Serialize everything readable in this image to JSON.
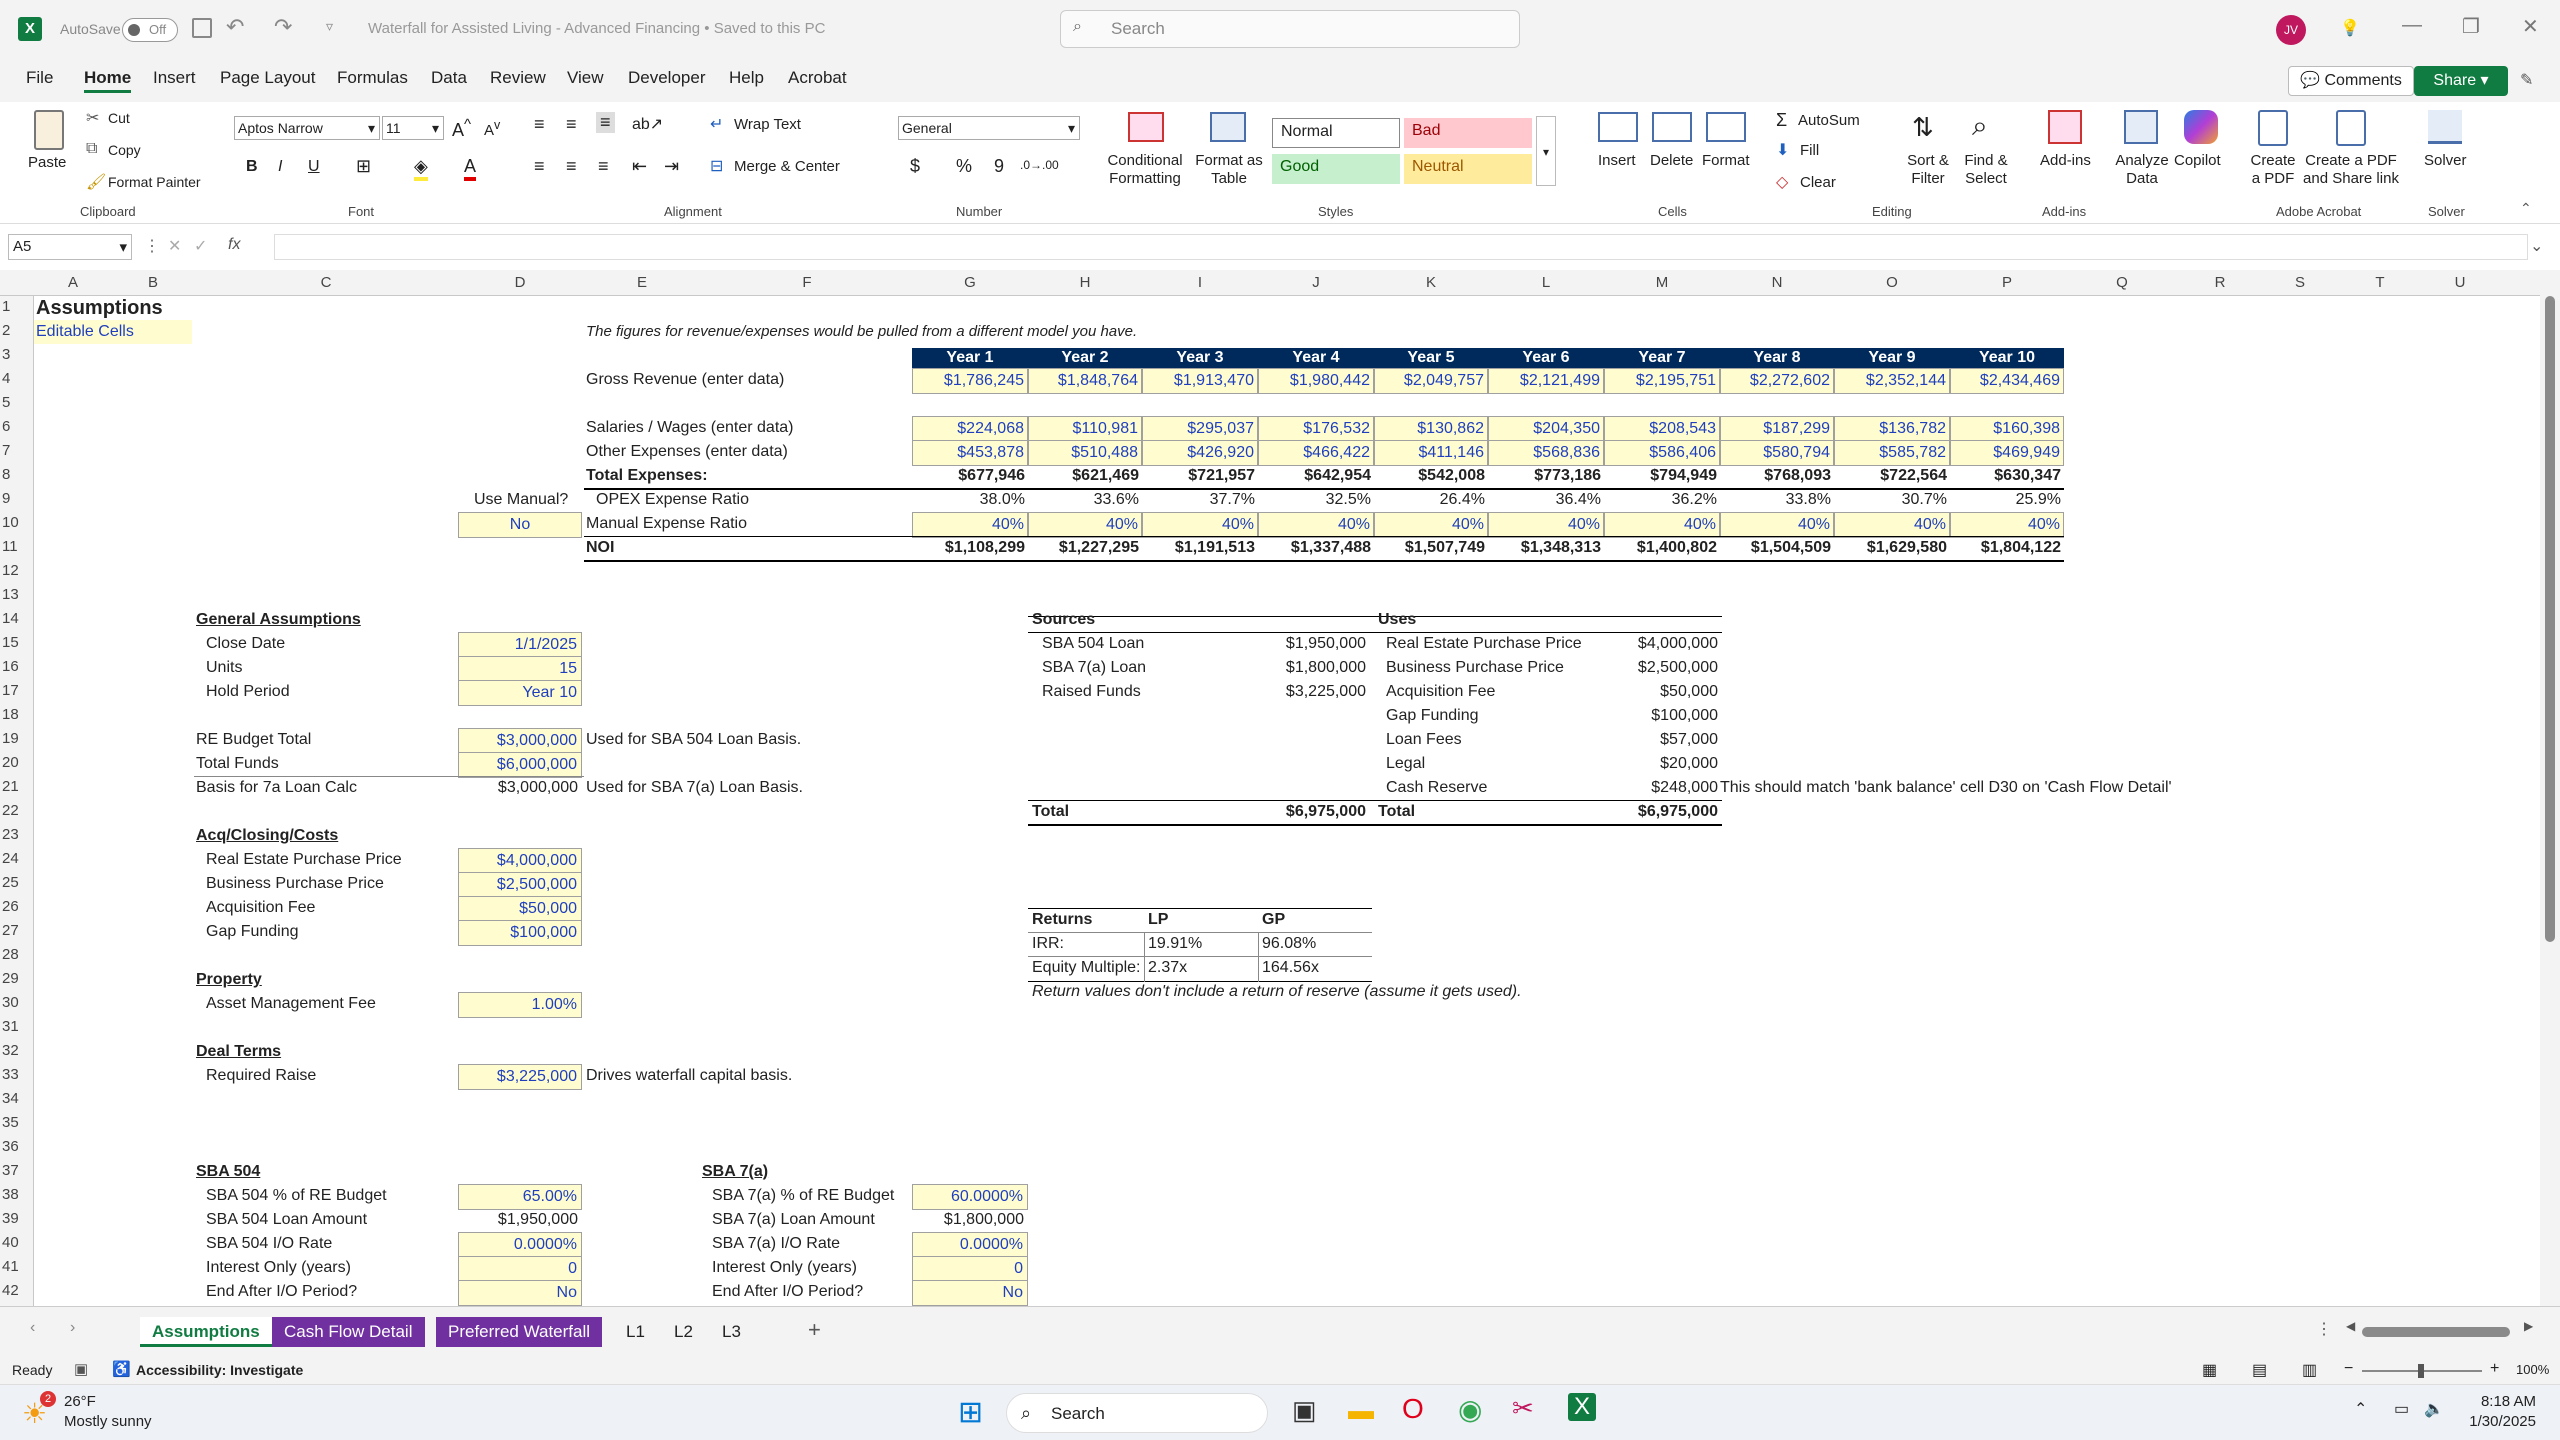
{
  "titlebar": {
    "autosave": "AutoSave",
    "autosave_state": "Off",
    "doc_title": "Waterfall for Assisted Living - Advanced Financing • Saved to this PC",
    "search_placeholder": "Search",
    "user_initials": "JV"
  },
  "menu": [
    "File",
    "Home",
    "Insert",
    "Page Layout",
    "Formulas",
    "Data",
    "Review",
    "View",
    "Developer",
    "Help",
    "Acrobat"
  ],
  "comments_label": "Comments",
  "share_label": "Share",
  "ribbon": {
    "clipboard": {
      "paste": "Paste",
      "cut": "Cut",
      "copy": "Copy",
      "format_painter": "Format Painter",
      "group": "Clipboard"
    },
    "font": {
      "name": "Aptos Narrow",
      "size": "11",
      "group": "Font"
    },
    "alignment": {
      "wrap": "Wrap Text",
      "merge": "Merge & Center",
      "group": "Alignment"
    },
    "number": {
      "format": "General",
      "group": "Number"
    },
    "styles": {
      "cond": "Conditional Formatting",
      "table": "Format as Table",
      "normal": "Normal",
      "bad": "Bad",
      "good": "Good",
      "neutral": "Neutral",
      "group": "Styles"
    },
    "cells": {
      "insert": "Insert",
      "delete": "Delete",
      "format": "Format",
      "group": "Cells"
    },
    "editing": {
      "autosum": "AutoSum",
      "fill": "Fill",
      "clear": "Clear",
      "sort": "Sort & Filter",
      "find": "Find & Select",
      "group": "Editing"
    },
    "addins": {
      "label": "Add-ins",
      "group": "Add-ins"
    },
    "analyze": "Analyze Data",
    "copilot": "Copilot",
    "acrobat": {
      "pdf": "Create a PDF",
      "share": "Create a PDF and Share link",
      "group": "Adobe Acrobat"
    },
    "solver": {
      "label": "Solver",
      "group": "Solver"
    }
  },
  "namebox": "A5",
  "fx": "fx",
  "columns": [
    "A",
    "B",
    "C",
    "D",
    "E",
    "F",
    "G",
    "H",
    "I",
    "J",
    "K",
    "L",
    "M",
    "N",
    "O",
    "P",
    "Q",
    "R",
    "S",
    "T",
    "U"
  ],
  "sheet": {
    "title": "Assumptions",
    "editable": "Editable Cells",
    "note": "The figures for revenue/expenses would be pulled from a different model you have.",
    "years": [
      "Year 1",
      "Year 2",
      "Year 3",
      "Year 4",
      "Year 5",
      "Year 6",
      "Year 7",
      "Year 8",
      "Year 9",
      "Year 10"
    ],
    "gross_label": "Gross Revenue (enter data)",
    "gross": [
      "$1,786,245",
      "$1,848,764",
      "$1,913,470",
      "$1,980,442",
      "$2,049,757",
      "$2,121,499",
      "$2,195,751",
      "$2,272,602",
      "$2,352,144",
      "$2,434,469"
    ],
    "sal_label": "Salaries / Wages (enter data)",
    "sal": [
      "$224,068",
      "$110,981",
      "$295,037",
      "$176,532",
      "$130,862",
      "$204,350",
      "$208,543",
      "$187,299",
      "$136,782",
      "$160,398"
    ],
    "oth_label": "Other Expenses (enter data)",
    "oth": [
      "$453,878",
      "$510,488",
      "$426,920",
      "$466,422",
      "$411,146",
      "$568,836",
      "$586,406",
      "$580,794",
      "$585,782",
      "$469,949"
    ],
    "tot_label": "Total Expenses:",
    "tot": [
      "$677,946",
      "$621,469",
      "$721,957",
      "$642,954",
      "$542,008",
      "$773,186",
      "$794,949",
      "$768,093",
      "$722,564",
      "$630,347"
    ],
    "use_manual_label": "Use Manual?",
    "use_manual": "No",
    "opex_label": "OPEX Expense Ratio",
    "opex": [
      "38.0%",
      "33.6%",
      "37.7%",
      "32.5%",
      "26.4%",
      "36.4%",
      "36.2%",
      "33.8%",
      "30.7%",
      "25.9%"
    ],
    "manual_label": "Manual Expense Ratio",
    "manual": [
      "40%",
      "40%",
      "40%",
      "40%",
      "40%",
      "40%",
      "40%",
      "40%",
      "40%",
      "40%"
    ],
    "noi_label": "NOI",
    "noi": [
      "$1,108,299",
      "$1,227,295",
      "$1,191,513",
      "$1,337,488",
      "$1,507,749",
      "$1,348,313",
      "$1,400,802",
      "$1,504,509",
      "$1,629,580",
      "$1,804,122"
    ],
    "general": {
      "heading": "General Assumptions",
      "close_label": "Close Date",
      "close": "1/1/2025",
      "units_label": "Units",
      "units": "15",
      "hold_label": "Hold Period",
      "hold": "Year 10"
    },
    "re_budget_label": "RE Budget Total",
    "re_budget": "$3,000,000",
    "re_note": "Used for SBA 504 Loan Basis.",
    "total_funds_label": "Total Funds",
    "total_funds": "$6,000,000",
    "basis_label": "Basis for 7a Loan Calc",
    "basis": "$3,000,000",
    "basis_note": "Used for SBA 7(a) Loan Basis.",
    "acq": {
      "heading": "Acq/Closing/Costs",
      "rep_label": "Real Estate Purchase Price",
      "rep": "$4,000,000",
      "bpp_label": "Business Purchase Price",
      "bpp": "$2,500,000",
      "af_label": "Acquisition Fee",
      "af": "$50,000",
      "gf_label": "Gap Funding",
      "gf": "$100,000"
    },
    "property": {
      "heading": "Property",
      "amf_label": "Asset Management Fee",
      "amf": "1.00%"
    },
    "deal": {
      "heading": "Deal Terms",
      "raise_label": "Required Raise",
      "raise": "$3,225,000",
      "raise_note": "Drives waterfall capital basis."
    },
    "sba504": {
      "heading": "SBA 504",
      "pct_label": "SBA 504 % of RE Budget",
      "pct": "65.00%",
      "amt_label": "SBA 504 Loan Amount",
      "amt": "$1,950,000",
      "io_label": "SBA 504 I/O Rate",
      "io": "0.0000%",
      "ioy_label": "Interest Only (years)",
      "ioy": "0",
      "end_label": "End After I/O Period?",
      "end": "No"
    },
    "sba7a": {
      "heading": "SBA 7(a)",
      "pct_label": "SBA 7(a) % of RE Budget",
      "pct": "60.0000%",
      "amt_label": "SBA 7(a) Loan Amount",
      "amt": "$1,800,000",
      "io_label": "SBA 7(a) I/O Rate",
      "io": "0.0000%",
      "ioy_label": "Interest Only (years)",
      "ioy": "0",
      "end_label": "End After I/O Period?",
      "end": "No"
    },
    "sources": {
      "heading": "Sources",
      "rows": [
        [
          "SBA 504 Loan",
          "$1,950,000"
        ],
        [
          "SBA 7(a) Loan",
          "$1,800,000"
        ],
        [
          "Raised Funds",
          "$3,225,000"
        ]
      ],
      "total_label": "Total",
      "total": "$6,975,000"
    },
    "uses": {
      "heading": "Uses",
      "rows": [
        [
          "Real Estate Purchase Price",
          "$4,000,000"
        ],
        [
          "Business Purchase Price",
          "$2,500,000"
        ],
        [
          "Acquisition Fee",
          "$50,000"
        ],
        [
          "Gap Funding",
          "$100,000"
        ],
        [
          "Loan Fees",
          "$57,000"
        ],
        [
          "Legal",
          "$20,000"
        ],
        [
          "Cash Reserve",
          "$248,000"
        ]
      ],
      "total_label": "Total",
      "total": "$6,975,000",
      "note": "This should match 'bank balance' cell D30 on 'Cash Flow Detail'"
    },
    "returns": {
      "heading": "Returns",
      "lp": "LP",
      "gp": "GP",
      "irr_label": "IRR:",
      "irr_lp": "19.91%",
      "irr_gp": "96.08%",
      "em_label": "Equity Multiple:",
      "em_lp": "2.37x",
      "em_gp": "164.56x",
      "note": "Return values don't include a return of reserve (assume it gets used)."
    }
  },
  "tabs": [
    "Assumptions",
    "Cash Flow Detail",
    "Preferred Waterfall",
    "L1",
    "L2",
    "L3"
  ],
  "status": {
    "ready": "Ready",
    "accessibility": "Accessibility: Investigate",
    "zoom": "100%"
  },
  "taskbar": {
    "temp": "26°F",
    "weather": "Mostly sunny",
    "search": "Search",
    "time": "8:18 AM",
    "date": "1/30/2025",
    "badge": "2"
  }
}
